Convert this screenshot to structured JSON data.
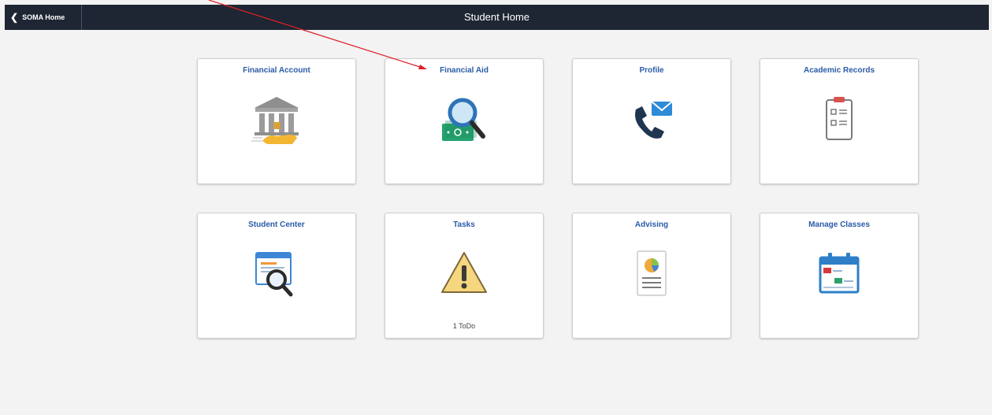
{
  "header": {
    "back_label": "SOMA Home",
    "title": "Student Home"
  },
  "tiles": [
    {
      "label": "Financial Account",
      "icon": "bank-icon"
    },
    {
      "label": "Financial Aid",
      "icon": "money-magnifier-icon"
    },
    {
      "label": "Profile",
      "icon": "phone-mail-icon"
    },
    {
      "label": "Academic Records",
      "icon": "clipboard-checklist-icon"
    },
    {
      "label": "Student Center",
      "icon": "window-search-icon"
    },
    {
      "label": "Tasks",
      "icon": "warning-icon",
      "count": "1 ToDo"
    },
    {
      "label": "Advising",
      "icon": "report-chart-icon"
    },
    {
      "label": "Manage Classes",
      "icon": "calendar-icon"
    }
  ],
  "colors": {
    "header_bg": "#1e2633",
    "tile_title": "#2a5ba8",
    "page_bg": "#f3f3f3",
    "annotation_arrow": "#e0202a"
  }
}
